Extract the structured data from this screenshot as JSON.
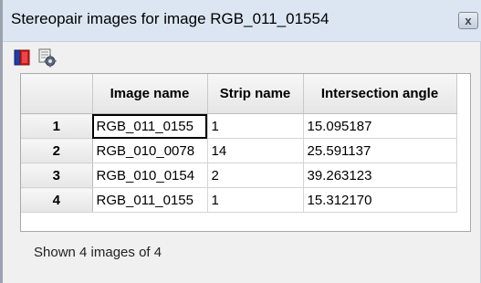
{
  "window": {
    "title": "Stereopair images for image RGB_011_01554",
    "close_label": "x"
  },
  "toolbar": {
    "buttons": [
      {
        "icon": "red-blue-stereo-icon"
      },
      {
        "icon": "gear-settings-icon"
      }
    ]
  },
  "table": {
    "columns": [
      "Image name",
      "Strip name",
      "Intersection angle"
    ],
    "rows": [
      {
        "num": "1",
        "image": "RGB_011_0155",
        "strip": "1",
        "angle": "15.095187"
      },
      {
        "num": "2",
        "image": "RGB_010_0078",
        "strip": "14",
        "angle": "25.591137"
      },
      {
        "num": "3",
        "image": "RGB_010_0154",
        "strip": "2",
        "angle": "39.263123"
      },
      {
        "num": "4",
        "image": "RGB_011_0155",
        "strip": "1",
        "angle": "15.312170"
      }
    ]
  },
  "status": {
    "text": "Shown 4 images of 4"
  },
  "colors": {
    "titlebar": "#dce6f2",
    "window_bg": "#f0f0f0",
    "selection_border": "#000000"
  }
}
